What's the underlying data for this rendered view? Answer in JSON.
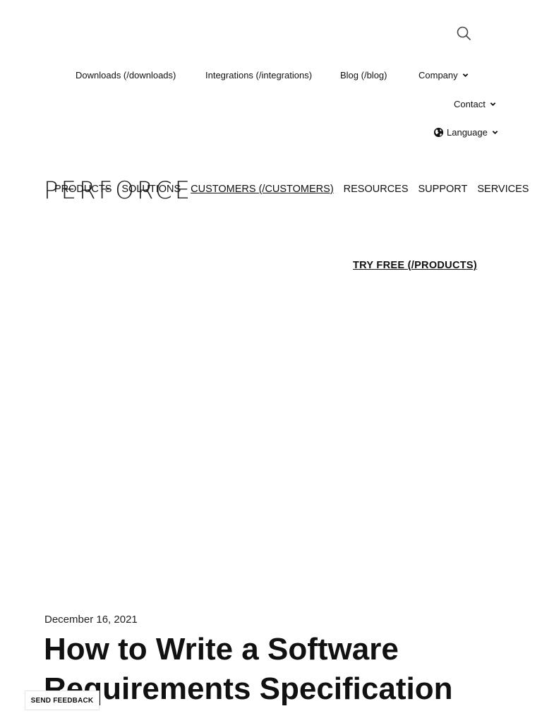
{
  "header": {
    "search_icon": "search-icon",
    "utility_nav": [
      {
        "label": "Downloads (/downloads)"
      },
      {
        "label": "Integrations (/integrations)"
      },
      {
        "label": "Blog (/blog)"
      },
      {
        "label": "Company"
      },
      {
        "label": "Contact"
      },
      {
        "label": "Language"
      }
    ],
    "logo_text": "PERFORCE",
    "main_nav": [
      {
        "label": "PRODUCTS"
      },
      {
        "label": "SOLUTIONS"
      },
      {
        "label": "CUSTOMERS (/CUSTOMERS)"
      },
      {
        "label": "RESOURCES"
      },
      {
        "label": "SUPPORT"
      },
      {
        "label": "SERVICES"
      }
    ],
    "cta_label": "TRY FREE (/PRODUCTS)"
  },
  "article": {
    "date": "December 16, 2021",
    "title": "How to Write a Software Requirements Specification"
  },
  "feedback": {
    "label": "SEND FEEDBACK"
  }
}
